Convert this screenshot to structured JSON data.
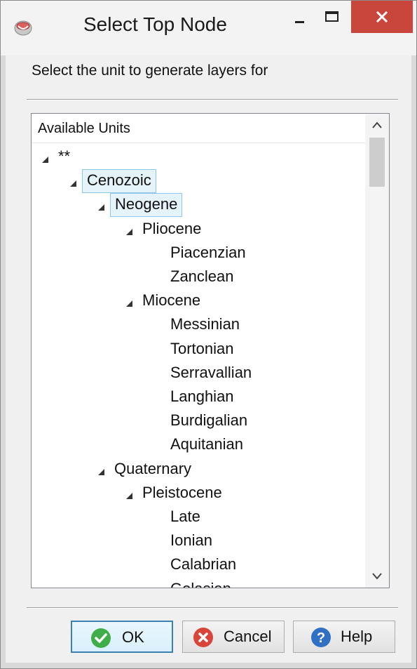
{
  "window": {
    "title": "Select Top Node",
    "controls": {
      "minimize": "minimize",
      "maximize": "maximize",
      "close": "close"
    }
  },
  "instruction": "Select the unit to generate layers for",
  "tree": {
    "header": "Available Units",
    "nodes": [
      {
        "label": "**",
        "level": 0,
        "expandable": true,
        "selected": false
      },
      {
        "label": "Cenozoic",
        "level": 1,
        "expandable": true,
        "selected": true
      },
      {
        "label": "Neogene",
        "level": 2,
        "expandable": true,
        "selected": true
      },
      {
        "label": "Pliocene",
        "level": 3,
        "expandable": true,
        "selected": false
      },
      {
        "label": "Piacenzian",
        "level": 4,
        "expandable": false,
        "selected": false
      },
      {
        "label": "Zanclean",
        "level": 4,
        "expandable": false,
        "selected": false
      },
      {
        "label": "Miocene",
        "level": 3,
        "expandable": true,
        "selected": false
      },
      {
        "label": "Messinian",
        "level": 4,
        "expandable": false,
        "selected": false
      },
      {
        "label": "Tortonian",
        "level": 4,
        "expandable": false,
        "selected": false
      },
      {
        "label": "Serravallian",
        "level": 4,
        "expandable": false,
        "selected": false
      },
      {
        "label": "Langhian",
        "level": 4,
        "expandable": false,
        "selected": false
      },
      {
        "label": "Burdigalian",
        "level": 4,
        "expandable": false,
        "selected": false
      },
      {
        "label": "Aquitanian",
        "level": 4,
        "expandable": false,
        "selected": false
      },
      {
        "label": "Quaternary",
        "level": 2,
        "expandable": true,
        "selected": false
      },
      {
        "label": "Pleistocene",
        "level": 3,
        "expandable": true,
        "selected": false
      },
      {
        "label": "Late",
        "level": 4,
        "expandable": false,
        "selected": false
      },
      {
        "label": "Ionian",
        "level": 4,
        "expandable": false,
        "selected": false
      },
      {
        "label": "Calabrian",
        "level": 4,
        "expandable": false,
        "selected": false
      },
      {
        "label": "Gelasian",
        "level": 4,
        "expandable": false,
        "selected": false
      }
    ]
  },
  "buttons": {
    "ok": "OK",
    "cancel": "Cancel",
    "help": "Help"
  },
  "colors": {
    "close_button": "#c9463d",
    "selection_fill": "#e5f3fb",
    "selection_border": "#8ec8e8",
    "ok_icon": "#3fae49",
    "cancel_icon": "#d9453a",
    "help_icon": "#2f6fc4"
  }
}
